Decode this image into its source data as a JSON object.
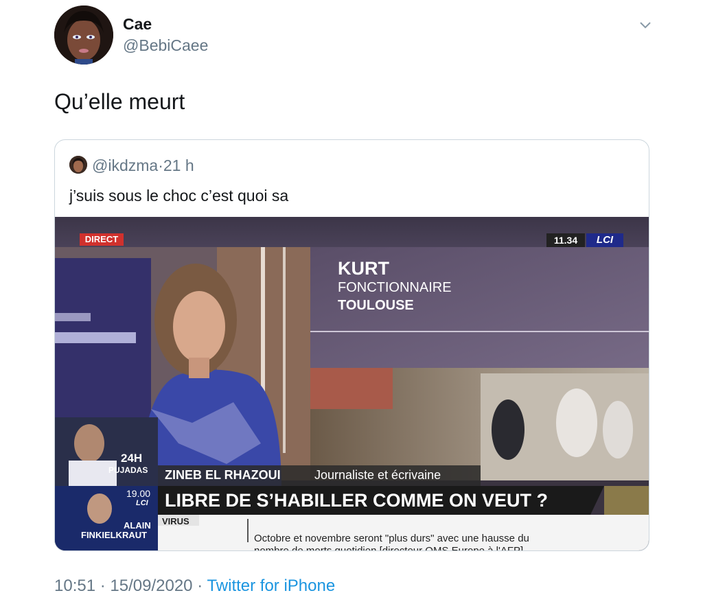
{
  "author": {
    "name": "Cae",
    "handle": "@BebiCaee"
  },
  "tweet": {
    "text": "Qu’elle meurt"
  },
  "quoted": {
    "handle": "@ikdzma",
    "separator": "·",
    "time": "21 h",
    "text": "j’suis sous le choc c’est quoi sa",
    "video": {
      "live_label": "DIRECT",
      "clock": "11.34",
      "channel": "LCI",
      "inset_name": "KURT",
      "inset_role": "FONCTIONNAIRE",
      "inset_city": "TOULOUSE",
      "guest_name": "ZINEB EL RHAZOUI",
      "guest_title": "Journaliste et écrivaine",
      "show_24h": "24H",
      "show_host": "PUJADAS",
      "next_time": "19.00",
      "next_channel": "LCI",
      "next_guest_1": "ALAIN",
      "next_guest_2": "FINKIELKRAUT",
      "headline": "LIBRE DE S’HABILLER COMME ON VEUT ?",
      "ticker_topic": "VIRUS",
      "ticker_line_1": "Octobre et novembre seront \"plus durs\" avec une hausse du",
      "ticker_line_2": "nombre de morts quotidien [directeur OMS Europe à l'AFP]"
    }
  },
  "footer": {
    "time": "10:51",
    "date": "15/09/2020",
    "dot": "·",
    "source": "Twitter for iPhone"
  },
  "colors": {
    "link": "#1b95e0",
    "muted": "#657786",
    "direct_red": "#d0312d",
    "headline_bg": "#1a1a1a"
  }
}
